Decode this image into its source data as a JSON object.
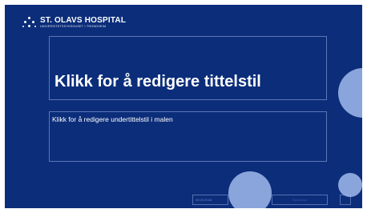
{
  "logo": {
    "title": "ST. OLAVS HOSPITAL",
    "subtitle": "UNIVERSITETSSYKEHUSET I TRONDHEIM"
  },
  "slide": {
    "title_placeholder": "Klikk for å redigere tittelstil",
    "subtitle_placeholder": "Klikk for å redigere undertittelstil i malen"
  },
  "footer": {
    "date": "09.05.2018",
    "text": "Bunntekst",
    "slide_number": "‹#›"
  },
  "colors": {
    "background": "#0b2d7a",
    "accent_circle": "#8aa4dc",
    "text": "#ffffff"
  }
}
